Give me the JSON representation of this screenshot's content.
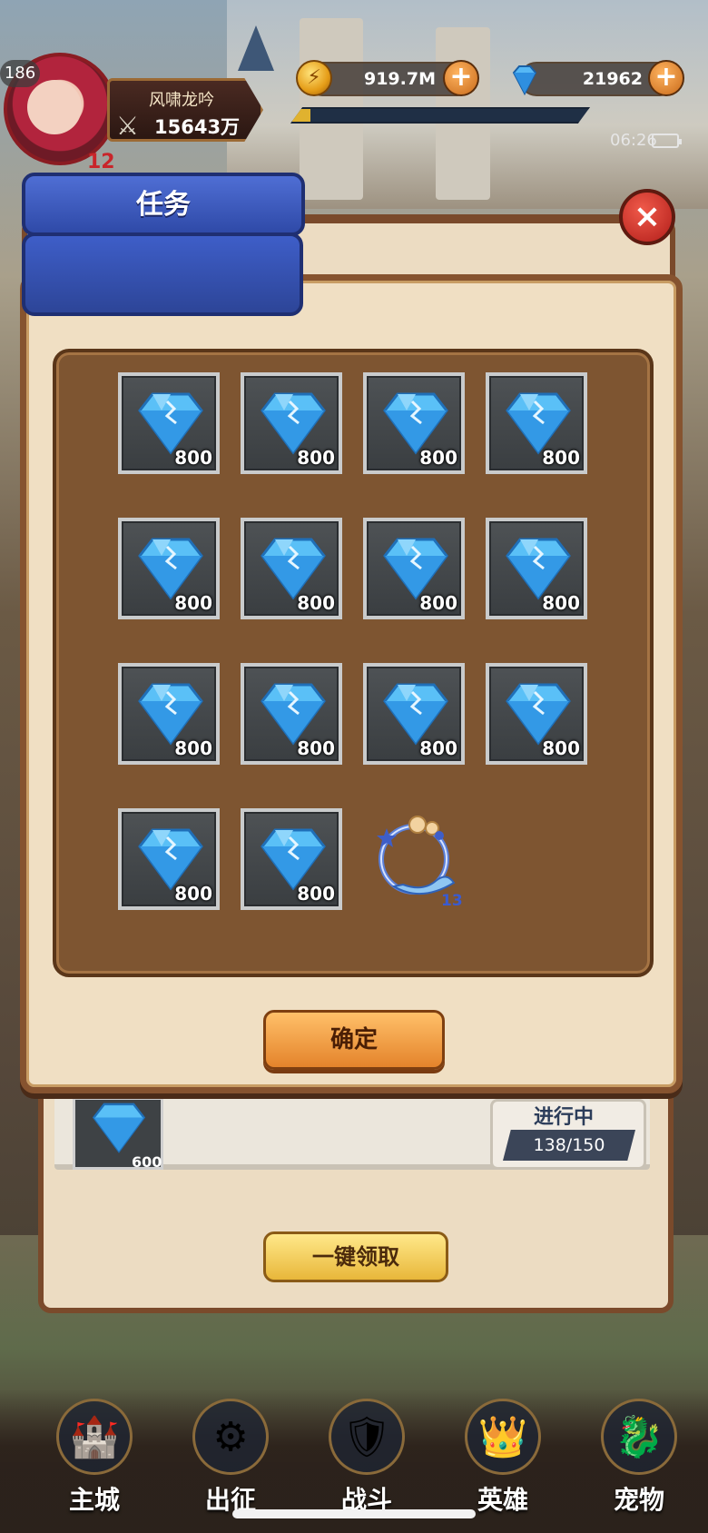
{
  "player": {
    "level": "186",
    "vip": "12",
    "name": "风啸龙吟",
    "power": "15643万"
  },
  "resources": {
    "gold": "919.7M",
    "gems": "21962",
    "exp_fraction": 0.06
  },
  "status_bar": {
    "time": "06:26"
  },
  "dialog": {
    "title": "任务",
    "close_icon": "×",
    "confirm_label": "确定",
    "rewards": [
      {
        "icon": "diamond-icon",
        "qty": "800"
      },
      {
        "icon": "diamond-icon",
        "qty": "800"
      },
      {
        "icon": "diamond-icon",
        "qty": "800"
      },
      {
        "icon": "diamond-icon",
        "qty": "800"
      },
      {
        "icon": "diamond-icon",
        "qty": "800"
      },
      {
        "icon": "diamond-icon",
        "qty": "800"
      },
      {
        "icon": "diamond-icon",
        "qty": "800"
      },
      {
        "icon": "diamond-icon",
        "qty": "800"
      },
      {
        "icon": "diamond-icon",
        "qty": "800"
      },
      {
        "icon": "diamond-icon",
        "qty": "800"
      },
      {
        "icon": "diamond-icon",
        "qty": "800"
      },
      {
        "icon": "diamond-icon",
        "qty": "800"
      },
      {
        "icon": "diamond-icon",
        "qty": "800"
      },
      {
        "icon": "diamond-icon",
        "qty": "800"
      }
    ],
    "frame_reward": {
      "icon": "avatar-frame-icon",
      "qty": "13"
    }
  },
  "task_panel": {
    "row_reward_qty": "600",
    "row_status": "进行中",
    "row_progress": "138/150",
    "claim_all_label": "一键领取"
  },
  "bottom_nav": [
    {
      "label": "主城",
      "icon": "castle-icon"
    },
    {
      "label": "出征",
      "icon": "expedition-icon"
    },
    {
      "label": "战斗",
      "icon": "battle-shield-icon"
    },
    {
      "label": "英雄",
      "icon": "hero-crest-icon"
    },
    {
      "label": "宠物",
      "icon": "pet-dragon-icon"
    }
  ],
  "colors": {
    "accent_blue": "#3e5ec8",
    "confirm_orange": "#e4842b",
    "close_red": "#b21e1a",
    "board_brown": "#7e5531"
  }
}
